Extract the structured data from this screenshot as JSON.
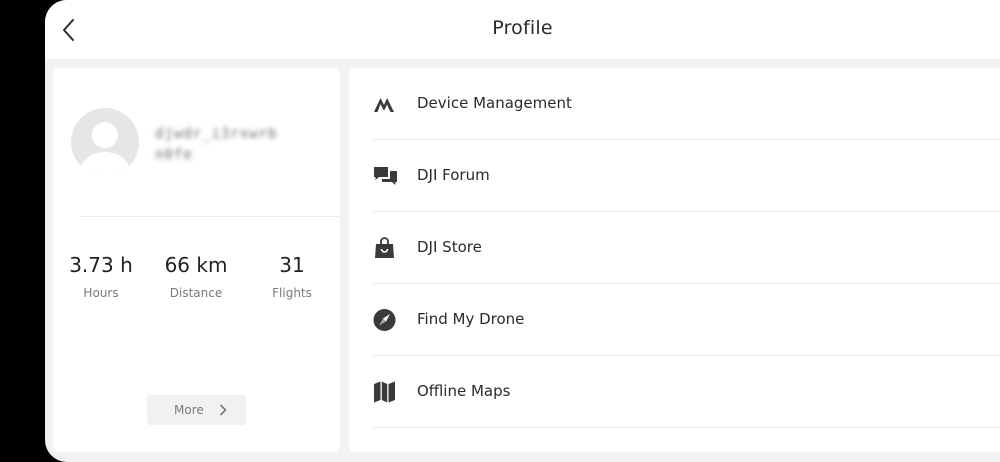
{
  "header": {
    "title": "Profile",
    "back_icon": "chevron-left-icon"
  },
  "profile": {
    "username_blurred": "djwdr_i3rxwrb n0fe",
    "avatar_icon": "default-avatar-icon",
    "stats": [
      {
        "value": "3.73 h",
        "label": "Hours"
      },
      {
        "value": "66 km",
        "label": "Distance"
      },
      {
        "value": "31",
        "label": "Flights"
      }
    ],
    "more_label": "More"
  },
  "menu": {
    "items": [
      {
        "label": "Device Management",
        "icon": "device-management-icon"
      },
      {
        "label": "DJI Forum",
        "icon": "forum-chat-icon"
      },
      {
        "label": "DJI Store",
        "icon": "shopping-bag-icon"
      },
      {
        "label": "Find My Drone",
        "icon": "compass-icon"
      },
      {
        "label": "Offline Maps",
        "icon": "map-icon"
      }
    ]
  },
  "colors": {
    "background": "#f2f2f2",
    "card": "#ffffff",
    "icon": "#3a3a3a",
    "text": "#2a2a2a",
    "muted": "#7a7a7a"
  }
}
